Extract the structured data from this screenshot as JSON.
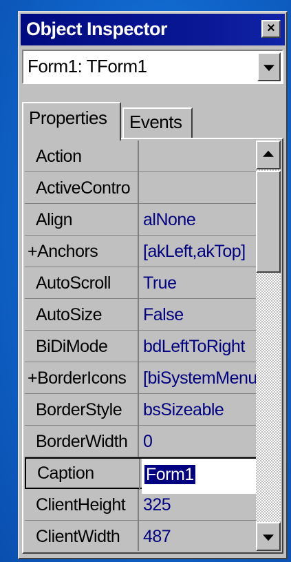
{
  "window": {
    "title": "Object Inspector",
    "close_glyph": "×"
  },
  "component_selector": {
    "value": "Form1: TForm1",
    "dropdown_icon": "chevron-down-icon"
  },
  "tabs": [
    {
      "label": "Properties",
      "active": true
    },
    {
      "label": "Events",
      "active": false
    }
  ],
  "properties": [
    {
      "name": "Action",
      "value": ""
    },
    {
      "name": "ActiveContro",
      "value": ""
    },
    {
      "name": "Align",
      "value": "alNone"
    },
    {
      "name": "+Anchors",
      "value": "[akLeft,akTop]"
    },
    {
      "name": "AutoScroll",
      "value": "True"
    },
    {
      "name": "AutoSize",
      "value": "False"
    },
    {
      "name": "BiDiMode",
      "value": "bdLeftToRight"
    },
    {
      "name": "+BorderIcons",
      "value": "[biSystemMenu"
    },
    {
      "name": "BorderStyle",
      "value": "bsSizeable"
    },
    {
      "name": "BorderWidth",
      "value": "0"
    },
    {
      "name": "Caption",
      "value": "Form1",
      "selected": true
    },
    {
      "name": "ClientHeight",
      "value": "325"
    },
    {
      "name": "ClientWidth",
      "value": "487"
    }
  ],
  "scrollbar": {
    "up_icon": "arrow-up-icon",
    "down_icon": "arrow-down-icon"
  },
  "colors": {
    "desktop": "#0f63c8",
    "titlebar": "#000a80",
    "value_text": "#000080",
    "selection": "#000080"
  }
}
